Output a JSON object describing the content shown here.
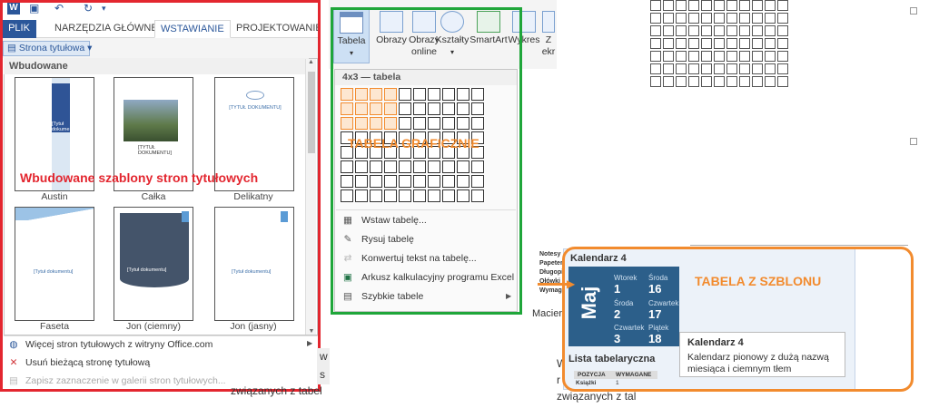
{
  "colors": {
    "word_blue": "#2b579a",
    "red_frame": "#e3262f",
    "green_frame": "#1fa63a",
    "orange_frame": "#f28b2e",
    "calendar_blue": "#2c5f8a"
  },
  "quick_access": {
    "icons": [
      "word-app-icon",
      "save-icon",
      "undo-icon",
      "redo-icon",
      "customize-icon"
    ]
  },
  "tabs": [
    {
      "label": "PLIK",
      "active": false
    },
    {
      "label": "NARZĘDZIA GŁÓWNE",
      "active": false
    },
    {
      "label": "WSTAWIANIE",
      "active": true
    },
    {
      "label": "PROJEKTOWANIE",
      "active": false
    }
  ],
  "cover_gallery": {
    "button_label": "Strona tytułowa",
    "section_header": "Wbudowane",
    "templates": [
      {
        "name": "Austin",
        "title_text": "[Tytuł dokumentu]"
      },
      {
        "name": "Całka",
        "title_text": "[TYTUŁ DOKUMENTU]"
      },
      {
        "name": "Delikatny",
        "title_text": "[TYTUŁ DOKUMENTU]"
      },
      {
        "name": "Faseta",
        "title_text": "[Tytuł dokumentu]"
      },
      {
        "name": "Jon (ciemny)",
        "title_text": "[Tytuł dokumentu]"
      },
      {
        "name": "Jon (jasny)",
        "title_text": "[Tytuł dokumentu]"
      }
    ],
    "overlay_caption": "Wbudowane szablony stron tytułowych",
    "menu": [
      {
        "label": "Więcej stron tytułowych z witryny Office.com",
        "icon": "office-globe-icon",
        "enabled": true,
        "submenu": true
      },
      {
        "label": "Usuń bieżącą stronę tytułową",
        "icon": "remove-page-icon",
        "enabled": true,
        "submenu": false
      },
      {
        "label": "Zapisz zaznaczenie w galerii stron tytułowych...",
        "icon": "save-selection-icon",
        "enabled": false,
        "submenu": false
      }
    ]
  },
  "insert_ribbon": {
    "buttons": [
      {
        "label": "Tabela",
        "icon": "table-icon",
        "dropdown": true,
        "active": true
      },
      {
        "label": "Obrazy",
        "icon": "picture-icon",
        "dropdown": false
      },
      {
        "label": "Obrazy online",
        "icon": "online-picture-icon",
        "dropdown": false
      },
      {
        "label": "Kształty",
        "icon": "shapes-icon",
        "dropdown": true
      },
      {
        "label": "SmartArt",
        "icon": "smartart-icon",
        "dropdown": false
      },
      {
        "label": "Wykres",
        "icon": "chart-icon",
        "dropdown": false
      },
      {
        "label": "Z ekr",
        "icon": "screenshot-icon",
        "dropdown": false
      }
    ]
  },
  "table_dropdown": {
    "header": "4x3 — tabela",
    "grid": {
      "cols": 10,
      "rows": 8,
      "selected_cols": 4,
      "selected_rows": 3
    },
    "overlay_caption": "TABELA GRAFICZNIE",
    "items": [
      {
        "label": "Wstaw tabelę...",
        "icon": "insert-table-icon",
        "enabled": true,
        "submenu": false
      },
      {
        "label": "Rysuj tabelę",
        "icon": "draw-table-icon",
        "enabled": true,
        "submenu": false
      },
      {
        "label": "Konwertuj tekst na tabelę...",
        "icon": "convert-text-icon",
        "enabled": false,
        "submenu": false
      },
      {
        "label": "Arkusz kalkulacyjny programu Excel",
        "icon": "excel-sheet-icon",
        "enabled": true,
        "submenu": false
      },
      {
        "label": "Szybkie tabele",
        "icon": "quick-tables-icon",
        "enabled": true,
        "submenu": true
      }
    ]
  },
  "background_doc": {
    "snippets": [
      "związanych z tabel",
      "w",
      "s",
      "W",
      "r",
      "związanych z tal",
      "Macier",
      "Notesy",
      "Papeter",
      "Długopi",
      "Ołówki",
      "Wymag"
    ]
  },
  "quick_tables": {
    "overlay_caption": "TABELA Z SZBLONU",
    "calendar": {
      "title": "Kalendarz 4",
      "month": "Maj",
      "days": [
        {
          "name": "Wtorek",
          "num": "1"
        },
        {
          "name": "Środa",
          "num": "16"
        },
        {
          "name": "Środa",
          "num": "2"
        },
        {
          "name": "Czwartek",
          "num": "17"
        },
        {
          "name": "Czwartek",
          "num": "3"
        },
        {
          "name": "Piątek",
          "num": "18"
        }
      ]
    },
    "tooltip": {
      "title": "Kalendarz 4",
      "description": "Kalendarz pionowy z dużą nazwą miesiąca i ciemnym tłem"
    },
    "list_title": "Lista tabelaryczna",
    "list_columns": [
      "POZYCJA",
      "WYMAGANE"
    ],
    "list_rows": [
      [
        "Książki",
        "1"
      ]
    ]
  }
}
